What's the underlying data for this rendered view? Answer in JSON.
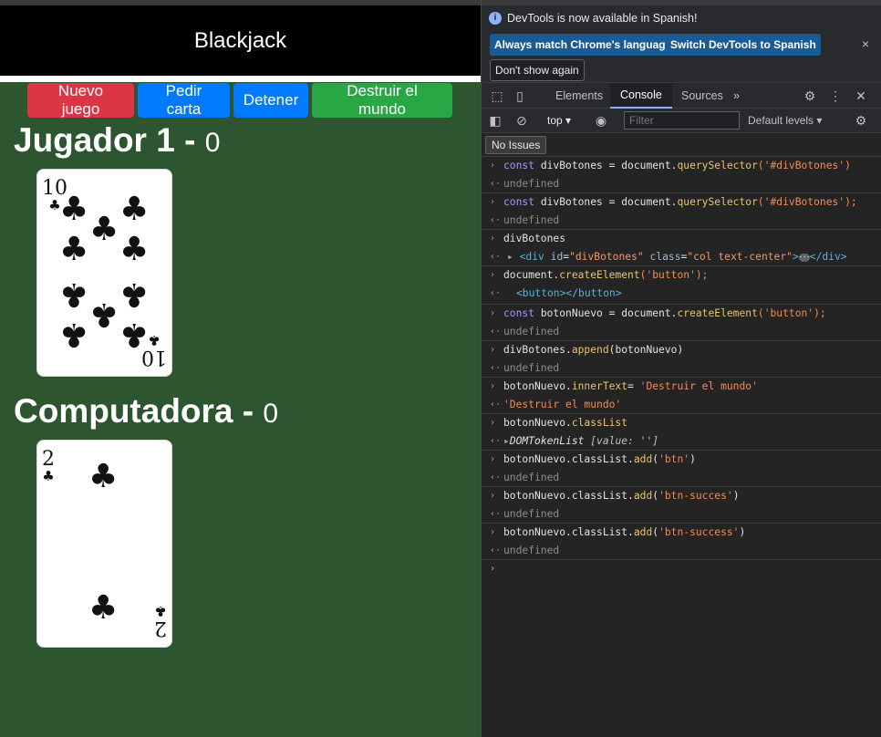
{
  "app": {
    "title": "Blackjack",
    "buttons": {
      "new_game": "Nuevo juego",
      "hit": "Pedir carta",
      "stand": "Detener",
      "destroy": "Destruir el mundo"
    },
    "player": {
      "name": "Jugador 1",
      "dash": "-",
      "score": "0",
      "card": {
        "rank": "10",
        "suit": "♣"
      }
    },
    "computer": {
      "name": "Computadora",
      "dash": "-",
      "score": "0",
      "card": {
        "rank": "2",
        "suit": "♣"
      }
    }
  },
  "devtools": {
    "info": {
      "icon": "info-icon",
      "message": "DevTools is now available in Spanish!",
      "match_btn": "Always match Chrome's language",
      "switch_btn": "Switch DevTools to Spanish",
      "dont_show": "Don't show again",
      "close": "×"
    },
    "tabs": {
      "elements": "Elements",
      "console": "Console",
      "sources": "Sources",
      "more": "»"
    },
    "toolbar": {
      "context": "top",
      "filter_placeholder": "Filter",
      "levels": "Default levels"
    },
    "issues": "No Issues",
    "console": {
      "l1": "divBotones = document.",
      "l1b": "querySelector",
      "l1c": "('#divBotones')",
      "r_undef": "undefined",
      "l2c": "('#divBotones');",
      "l3": "divBotones",
      "l4_tag_open": "<div",
      "l4_id_attr": "id",
      "l4_id_val": "\"divBotones\"",
      "l4_class_attr": "class",
      "l4_class_val": "\"col text-center\"",
      "l4_gt": ">",
      "l4_close": "</div>",
      "l5a": "document.",
      "l5b": "createElement",
      "l5c": "('button');",
      "l6": "<button></button>",
      "l7a": "botonNuevo = document.",
      "l8a": "divBotones.",
      "l8b": "append",
      "l8c": "(botonNuevo)",
      "l9a": "botonNuevo.",
      "l9b": "innerText",
      "l9c": "= ",
      "l9d": "'Destruir el mundo'",
      "l10": "'Destruir el mundo'",
      "l11b": "classList",
      "l12a": "DOMTokenList",
      "l12b": "[value: '']",
      "l13b": "classList.",
      "l13c": "add",
      "l13d": "'btn'",
      "l14d": "'btn-succes'",
      "l15d": "'btn-success'",
      "const": "const"
    }
  }
}
